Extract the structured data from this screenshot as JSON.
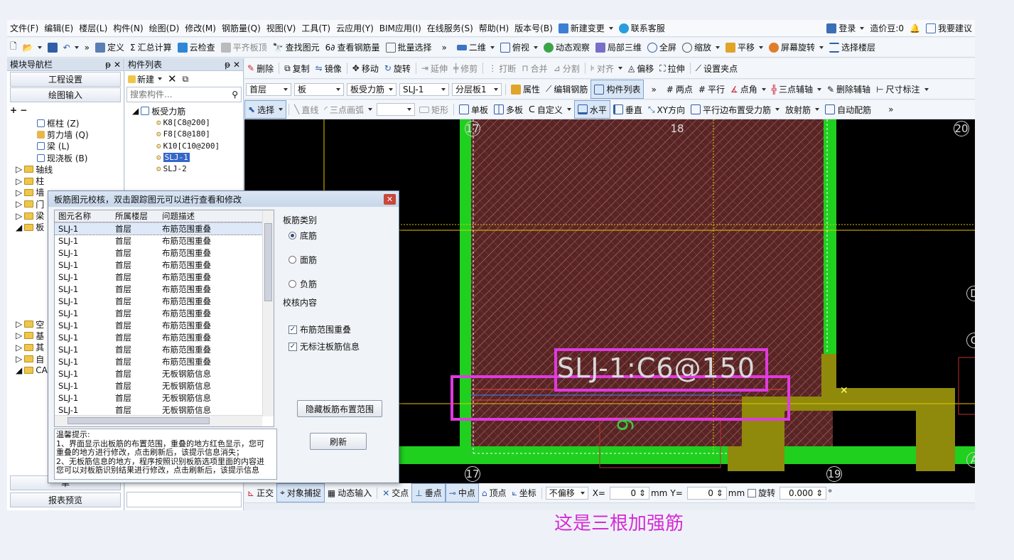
{
  "menu": [
    "文件(F)",
    "编辑(E)",
    "楼层(L)",
    "构件(N)",
    "绘图(D)",
    "修改(M)",
    "钢筋量(Q)",
    "视图(V)",
    "工具(T)",
    "云应用(Y)",
    "BIM应用(I)",
    "在线服务(S)",
    "帮助(H)",
    "版本号(B)",
    "新建变更",
    "联系客服"
  ],
  "menu_right": {
    "login": "登录",
    "cost_beans": "造价豆:0",
    "suggest": "我要建议"
  },
  "toolbar1": [
    "定义",
    "汇总计算",
    "云检查",
    "平齐板顶",
    "查找图元",
    "查看钢筋量",
    "批量选择",
    "二维",
    "俯视",
    "动态观察",
    "局部三维",
    "全屏",
    "缩放",
    "平移",
    "屏幕旋转",
    "选择楼层"
  ],
  "toolbar2": [
    "删除",
    "复制",
    "镜像",
    "移动",
    "旋转",
    "延伸",
    "修剪",
    "打断",
    "合并",
    "分割",
    "对齐",
    "偏移",
    "拉伸",
    "设置夹点"
  ],
  "toolbar3": {
    "floor": "首层",
    "type": "板",
    "subtype": "板受力筋",
    "element": "SLJ-1",
    "layer": "分层板1",
    "items": [
      "属性",
      "编辑钢筋",
      "构件列表",
      "两点",
      "平行",
      "点角",
      "三点辅轴",
      "删除辅轴",
      "尺寸标注"
    ]
  },
  "toolbar4": [
    "选择",
    "直线",
    "三点画弧",
    "矩形",
    "单板",
    "多板",
    "自定义",
    "水平",
    "垂直",
    "XY方向",
    "平行边布置受力筋",
    "放射筋",
    "自动配筋"
  ],
  "nav": {
    "title": "模块导航栏",
    "btn1": "工程设置",
    "btn2": "绘图输入",
    "tree": [
      "框柱 (Z)",
      "剪力墙 (Q)",
      "梁 (L)",
      "现浇板 (B)",
      "轴线",
      "柱",
      "墙",
      "门",
      "梁",
      "板",
      "空",
      "基",
      "其",
      "自",
      "CA"
    ],
    "bottom1": "单",
    "bottom2": "报表预览"
  },
  "complist": {
    "title": "构件列表",
    "new": "新建",
    "search_placeholder": "搜索构件...",
    "root": "板受力筋",
    "items": [
      "K8[C8@200]",
      "F8[C8@180]",
      "K10[C10@200]",
      "SLJ-1",
      "SLJ-2"
    ]
  },
  "dialog": {
    "title": "板筋图元校核，双击跟踪图元可以进行查看和修改",
    "headers": [
      "图元名称",
      "所属楼层",
      "问题描述"
    ],
    "rows": [
      [
        "SLJ-1",
        "首层",
        "布筋范围重叠"
      ],
      [
        "SLJ-1",
        "首层",
        "布筋范围重叠"
      ],
      [
        "SLJ-1",
        "首层",
        "布筋范围重叠"
      ],
      [
        "SLJ-1",
        "首层",
        "布筋范围重叠"
      ],
      [
        "SLJ-1",
        "首层",
        "布筋范围重叠"
      ],
      [
        "SLJ-1",
        "首层",
        "布筋范围重叠"
      ],
      [
        "SLJ-1",
        "首层",
        "布筋范围重叠"
      ],
      [
        "SLJ-1",
        "首层",
        "布筋范围重叠"
      ],
      [
        "SLJ-1",
        "首层",
        "布筋范围重叠"
      ],
      [
        "SLJ-1",
        "首层",
        "布筋范围重叠"
      ],
      [
        "SLJ-1",
        "首层",
        "布筋范围重叠"
      ],
      [
        "SLJ-1",
        "首层",
        "布筋范围重叠"
      ],
      [
        "SLJ-1",
        "首层",
        "无板钢筋信息"
      ],
      [
        "SLJ-1",
        "首层",
        "无板钢筋信息"
      ],
      [
        "SLJ-1",
        "首层",
        "无板钢筋信息"
      ],
      [
        "SLJ-1",
        "首层",
        "无板钢筋信息"
      ]
    ],
    "type_label": "板筋类别",
    "radios": [
      "底筋",
      "面筋",
      "负筋"
    ],
    "content_label": "校核内容",
    "checks": [
      "布筋范围重叠",
      "无标注板筋信息"
    ],
    "hide_btn": "隐藏板筋布置范围",
    "refresh_btn": "刷新",
    "tips": [
      "温馨提示:",
      "1、界面显示出板筋的布置范围，重叠的地方红色显示，您可",
      "重叠的地方进行修改，点击刷新后，该提示信息消失；",
      "2、无板筋信息的地方，程序按照识别板筋选项里面的内容进",
      "您可以对板筋识别结果进行修改，点击刷新后，该提示信息"
    ]
  },
  "canvas": {
    "grid_nums": [
      "18",
      "20",
      "17",
      "19",
      "D",
      "C",
      "A"
    ],
    "label": "SLJ-1:C6@150",
    "vlabel": "9"
  },
  "status": {
    "items": [
      "正交",
      "对象捕捉",
      "动态输入",
      "交点",
      "垂点",
      "中点",
      "顶点",
      "坐标"
    ],
    "offset": "不偏移",
    "x_label": "X=",
    "x_val": "0",
    "y_label": "Y=",
    "y_val": "0",
    "unit": "mm",
    "rotate": "旋转",
    "rotate_val": "0.000",
    "deg": "°"
  },
  "annotation": "这是三根加强筋"
}
